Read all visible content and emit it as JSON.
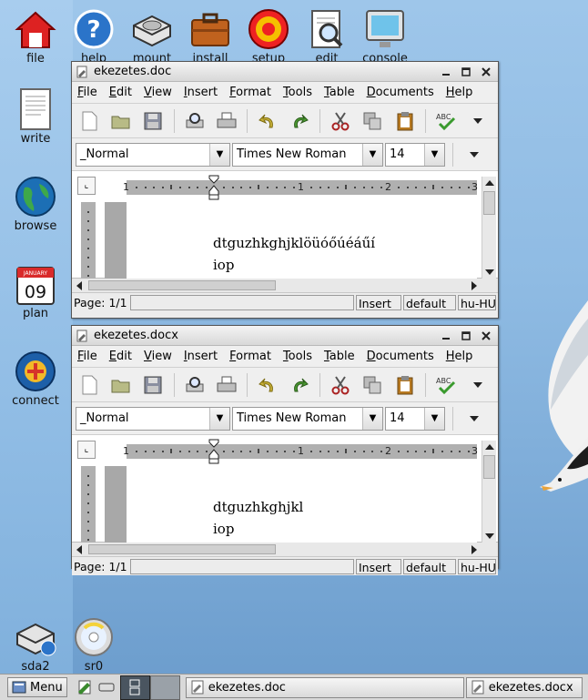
{
  "desktop": {
    "top_icons": [
      {
        "label": "file",
        "icon": "home-icon"
      },
      {
        "label": "help",
        "icon": "help-icon"
      },
      {
        "label": "mount",
        "icon": "drive-icon"
      },
      {
        "label": "install",
        "icon": "briefcase-icon"
      },
      {
        "label": "setup",
        "icon": "target-icon"
      },
      {
        "label": "edit",
        "icon": "document-magnifier-icon"
      },
      {
        "label": "console",
        "icon": "monitor-icon"
      }
    ],
    "side_icons": [
      {
        "label": "write",
        "icon": "document-icon"
      },
      {
        "label": "browse",
        "icon": "globe-icon"
      },
      {
        "label": "plan",
        "icon": "calendar-icon",
        "calendar_month": "JANUARY",
        "calendar_day": "09"
      },
      {
        "label": "connect",
        "icon": "connect-icon"
      },
      {
        "label": "sda2",
        "icon": "drive-icon"
      },
      {
        "label": "sr0",
        "icon": "cdrom-icon"
      }
    ]
  },
  "windows": [
    {
      "title": "ekezetes.doc",
      "menu": [
        "File",
        "Edit",
        "View",
        "Insert",
        "Format",
        "Tools",
        "Table",
        "Documents",
        "Help"
      ],
      "style": "_Normal",
      "font": "Times New Roman",
      "size": "14",
      "ruler_numbers": [
        "1",
        "1",
        "2",
        "3"
      ],
      "lines": [
        "dtguzhkghjklöüóőúéáűí",
        "iop"
      ],
      "status": {
        "page": "Page: 1/1",
        "blank": "",
        "mode": "Insert",
        "style": "default",
        "lang": "hu-HU"
      }
    },
    {
      "title": "ekezetes.docx",
      "menu": [
        "File",
        "Edit",
        "View",
        "Insert",
        "Format",
        "Tools",
        "Table",
        "Documents",
        "Help"
      ],
      "style": "_Normal",
      "font": "Times New Roman",
      "size": "14",
      "ruler_numbers": [
        "1",
        "1",
        "2",
        "3"
      ],
      "lines": [
        "dtguzhkghjkl",
        "iop"
      ],
      "status": {
        "page": "Page: 1/1",
        "blank": "",
        "mode": "Insert",
        "style": "default",
        "lang": "hu-HU"
      }
    }
  ],
  "taskbar": {
    "menu_label": "Menu",
    "tasks": [
      "ekezetes.doc",
      "ekezetes.docx"
    ]
  },
  "colors": {
    "sky": "#8fbbe3",
    "window_bg": "#ececec",
    "ruler_gray": "#b0b0b0"
  }
}
